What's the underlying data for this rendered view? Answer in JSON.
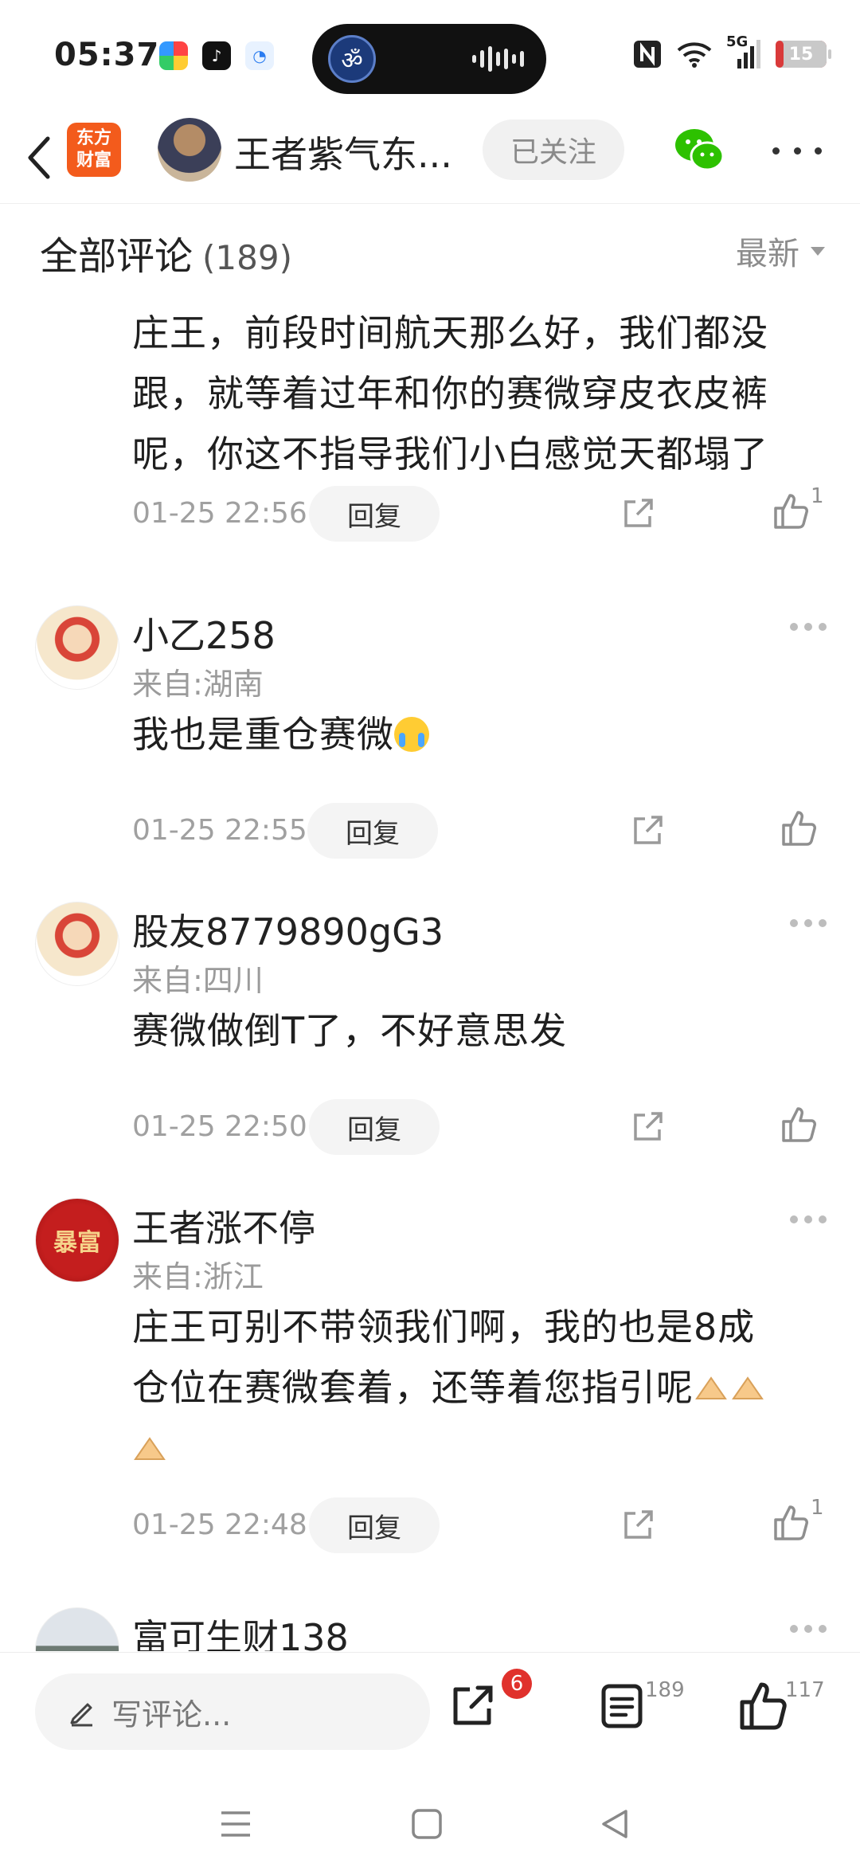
{
  "status_bar": {
    "time": "05:37",
    "network": "5G",
    "battery": "15",
    "battery_level": 0.15
  },
  "nav": {
    "app_logo_line1": "东方",
    "app_logo_line2": "财富",
    "username": "王者紫气东...",
    "follow_label": "已关注"
  },
  "comments_header": {
    "title": "全部评论",
    "count": "(189)",
    "sort_label": "最新"
  },
  "comments": [
    {
      "text": "庄王，前段时间航天那么好，我们都没跟，就等着过年和你的赛微穿皮衣皮裤呢，你这不指导我们小白感觉天都塌了",
      "time": "01-25 22:56",
      "reply_label": "回复",
      "likes": "1"
    },
    {
      "name": "小乙258",
      "location": "来自:湖南",
      "text": "我也是重仓赛微",
      "time": "01-25 22:55",
      "reply_label": "回复",
      "likes": ""
    },
    {
      "name": "股友8779890gG3",
      "location": "来自:四川",
      "text": "赛微做倒T了，不好意思发",
      "time": "01-25 22:50",
      "reply_label": "回复",
      "likes": ""
    },
    {
      "name": "王者涨不停",
      "location": "来自:浙江",
      "avatar_text": "暴富",
      "text_line1": "庄王可别不带领我们啊，我的也是8成",
      "text_line2": "仓位在赛微套着，还等着您指引呢",
      "time": "01-25 22:48",
      "reply_label": "回复",
      "likes": "1"
    },
    {
      "name": "富可生财138"
    }
  ],
  "bottom_bar": {
    "comment_placeholder": "写评论...",
    "share_badge": "6",
    "comment_count": "189",
    "like_count": "117"
  },
  "colors": {
    "accent_red": "#e0312c",
    "brand_orange": "#f35b1c",
    "wechat_green": "#2dc100"
  }
}
